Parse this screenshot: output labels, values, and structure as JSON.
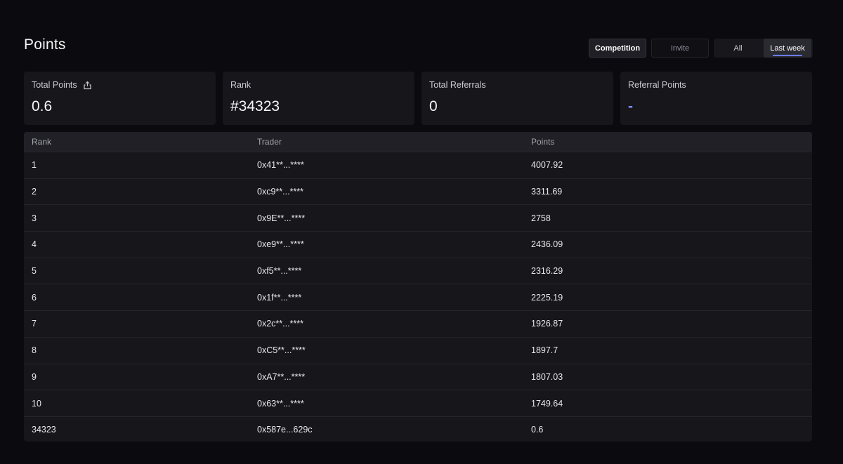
{
  "page": {
    "title": "Points"
  },
  "controls": {
    "competition": "Competition",
    "invite": "Invite",
    "all": "All",
    "last_week": "Last week"
  },
  "stats": {
    "total_points": {
      "label": "Total Points",
      "value": "0.6",
      "icon": "share-icon"
    },
    "rank": {
      "label": "Rank",
      "value": "#34323"
    },
    "total_referrals": {
      "label": "Total Referrals",
      "value": "0"
    },
    "referral_points": {
      "label": "Referral Points",
      "value": "-"
    }
  },
  "table": {
    "headers": {
      "rank": "Rank",
      "trader": "Trader",
      "points": "Points"
    },
    "rows": [
      {
        "rank": "1",
        "trader": "0x41**...****",
        "points": "4007.92"
      },
      {
        "rank": "2",
        "trader": "0xc9**...****",
        "points": "3311.69"
      },
      {
        "rank": "3",
        "trader": "0x9E**...****",
        "points": "2758"
      },
      {
        "rank": "4",
        "trader": "0xe9**...****",
        "points": "2436.09"
      },
      {
        "rank": "5",
        "trader": "0xf5**...****",
        "points": "2316.29"
      },
      {
        "rank": "6",
        "trader": "0x1f**...****",
        "points": "2225.19"
      },
      {
        "rank": "7",
        "trader": "0x2c**...****",
        "points": "1926.87"
      },
      {
        "rank": "8",
        "trader": "0xC5**...****",
        "points": "1897.7"
      },
      {
        "rank": "9",
        "trader": "0xA7**...****",
        "points": "1807.03"
      },
      {
        "rank": "10",
        "trader": "0x63**...****",
        "points": "1749.64"
      },
      {
        "rank": "34323",
        "trader": "0x587e...629c",
        "points": "0.6"
      }
    ]
  },
  "colors": {
    "background": "#0b0b0f",
    "card": "#16161b",
    "accent": "#6b7cff"
  }
}
